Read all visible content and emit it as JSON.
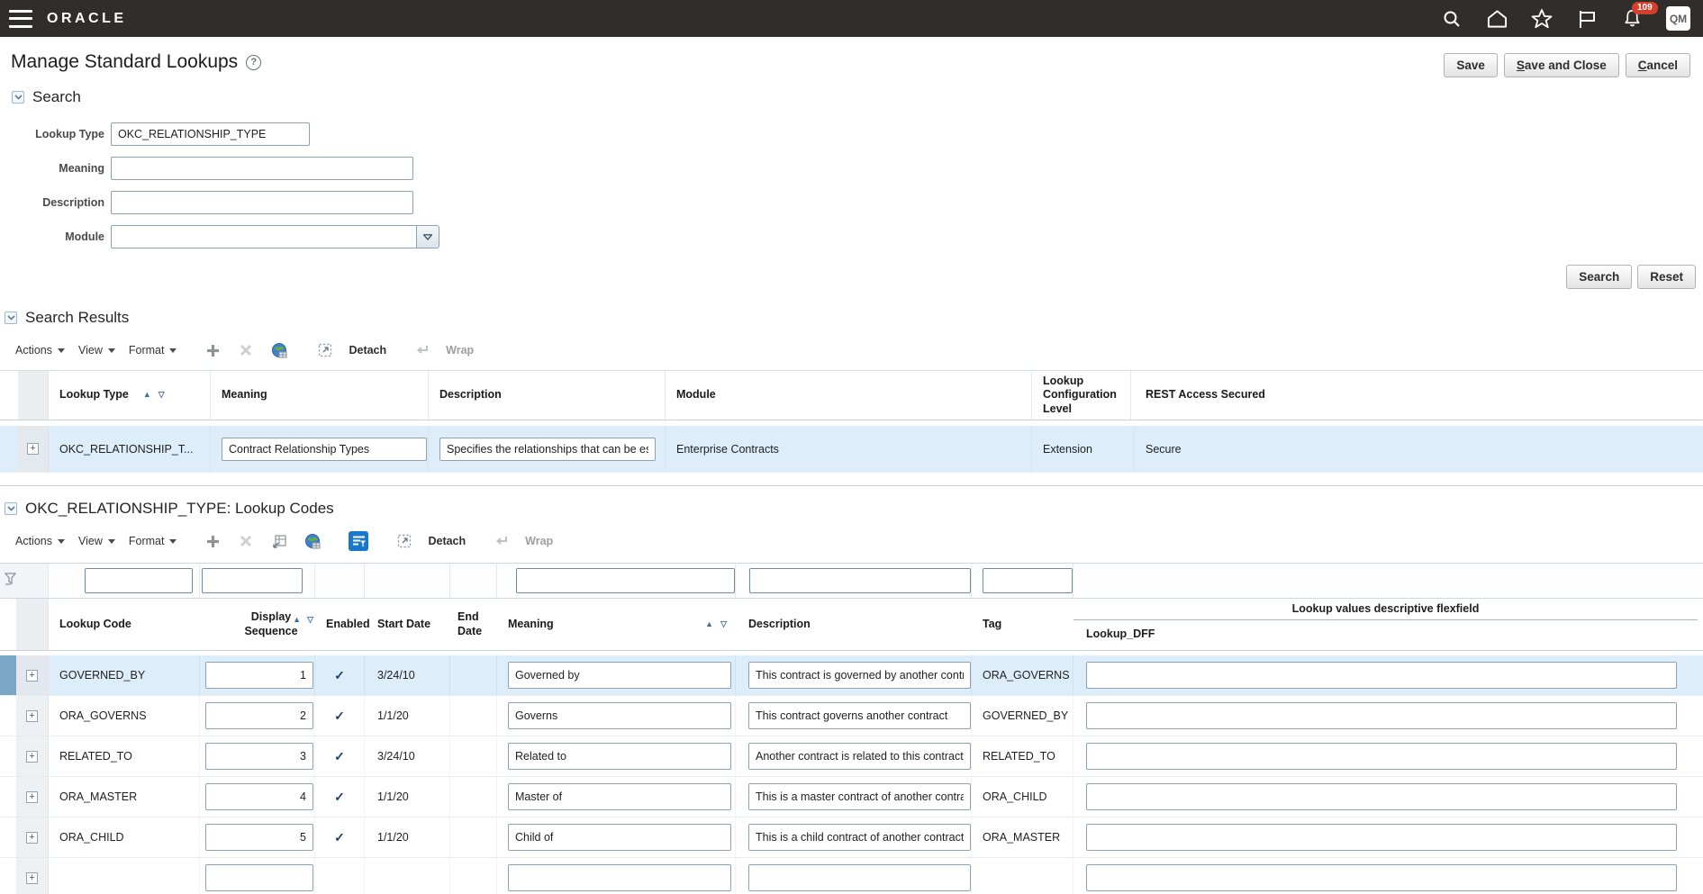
{
  "topbar": {
    "brand": "ORACLE",
    "notification_count": "109",
    "avatar_initials": "QM"
  },
  "header": {
    "title": "Manage Standard Lookups",
    "buttons": {
      "save": "Save",
      "save_and_close_key": "S",
      "save_and_close_rest": "ave and Close",
      "cancel_key": "C",
      "cancel_rest": "ancel"
    }
  },
  "search": {
    "title": "Search",
    "lookup_type_label": "Lookup Type",
    "lookup_type_value": "OKC_RELATIONSHIP_TYPE",
    "meaning_label": "Meaning",
    "meaning_value": "",
    "description_label": "Description",
    "description_value": "",
    "module_label": "Module",
    "module_value": "",
    "search_button": "Search",
    "reset_button": "Reset"
  },
  "toolbar": {
    "actions": "Actions",
    "view": "View",
    "format": "Format",
    "detach": "Detach",
    "wrap": "Wrap"
  },
  "sort_icons": {
    "asc": "▲",
    "desc": "▽"
  },
  "expand_glyph": "+",
  "search_results": {
    "title": "Search Results",
    "columns": {
      "lookup_type": "Lookup Type",
      "meaning": "Meaning",
      "description": "Description",
      "module": "Module",
      "config_level": "Lookup Configuration Level",
      "rest_access": "REST Access Secured"
    },
    "row": {
      "lookup_type": "OKC_RELATIONSHIP_T...",
      "meaning": "Contract Relationship Types",
      "description": "Specifies the relationships that can be establ",
      "module": "Enterprise Contracts",
      "config_level": "Extension",
      "rest_access": "Secure"
    }
  },
  "lookup_codes": {
    "title": "OKC_RELATIONSHIP_TYPE: Lookup Codes",
    "group_header": "Lookup values descriptive flexfield",
    "columns": {
      "lookup_code": "Lookup Code",
      "display_sequence": "Display Sequence",
      "enabled": "Enabled",
      "start_date": "Start Date",
      "end_date": "End Date",
      "meaning": "Meaning",
      "description": "Description",
      "tag": "Tag",
      "lookup_dff": "Lookup_DFF"
    },
    "rows": [
      {
        "code": "GOVERNED_BY",
        "seq": "1",
        "enabled": "✓",
        "start_date": "3/24/10",
        "end_date": "",
        "meaning": "Governed by",
        "description": "This contract is governed by another contrac",
        "tag": "ORA_GOVERNS",
        "dff": ""
      },
      {
        "code": "ORA_GOVERNS",
        "seq": "2",
        "enabled": "✓",
        "start_date": "1/1/20",
        "end_date": "",
        "meaning": "Governs",
        "description": "This contract governs another contract",
        "tag": "GOVERNED_BY",
        "dff": ""
      },
      {
        "code": "RELATED_TO",
        "seq": "3",
        "enabled": "✓",
        "start_date": "3/24/10",
        "end_date": "",
        "meaning": "Related to",
        "description": "Another contract is related to this contract.",
        "tag": "RELATED_TO",
        "dff": ""
      },
      {
        "code": "ORA_MASTER",
        "seq": "4",
        "enabled": "✓",
        "start_date": "1/1/20",
        "end_date": "",
        "meaning": "Master of",
        "description": "This is a master contract of another contract.",
        "tag": "ORA_CHILD",
        "dff": ""
      },
      {
        "code": "ORA_CHILD",
        "seq": "5",
        "enabled": "✓",
        "start_date": "1/1/20",
        "end_date": "",
        "meaning": "Child of",
        "description": "This is a child contract of another contract.",
        "tag": "ORA_MASTER",
        "dff": ""
      }
    ]
  }
}
